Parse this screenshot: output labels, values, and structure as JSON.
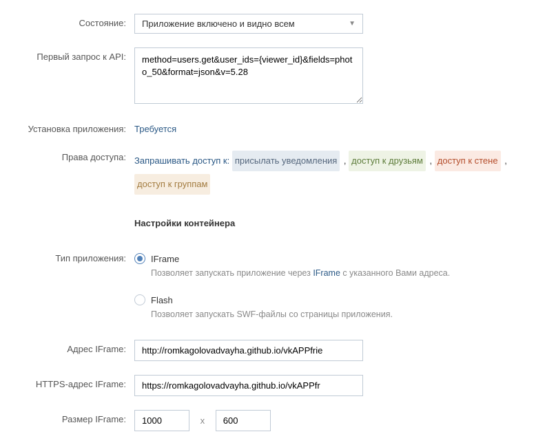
{
  "state": {
    "label": "Состояние:",
    "value": "Приложение включено и видно всем"
  },
  "first_api": {
    "label": "Первый запрос к API:",
    "value": "method=users.get&user_ids={viewer_id}&fields=photo_50&format=json&v=5.28"
  },
  "install": {
    "label": "Установка приложения:",
    "value": "Требуется"
  },
  "permissions": {
    "label": "Права доступа:",
    "prefix": "Запрашивать доступ к:",
    "items": [
      "присылать уведомления",
      "доступ к друзьям",
      "доступ к стене",
      "доступ к группам"
    ]
  },
  "container": {
    "header": "Настройки контейнера"
  },
  "app_type": {
    "label": "Тип приложения:",
    "iframe": {
      "name": "IFrame",
      "hint_prefix": "Позволяет запускать приложение через ",
      "hint_link": "IFrame",
      "hint_suffix": " с указанного Вами адреса."
    },
    "flash": {
      "name": "Flash",
      "hint": "Позволяет запускать SWF-файлы со страницы приложения."
    }
  },
  "iframe_addr": {
    "label": "Адрес IFrame:",
    "value": "http://romkagolovadvayha.github.io/vkAPPfrie"
  },
  "iframe_https": {
    "label": "HTTPS-адрес IFrame:",
    "value": "https://romkagolovadvayha.github.io/vkAPPfr"
  },
  "iframe_size": {
    "label": "Размер IFrame:",
    "width": "1000",
    "height": "600",
    "sep": "x"
  }
}
